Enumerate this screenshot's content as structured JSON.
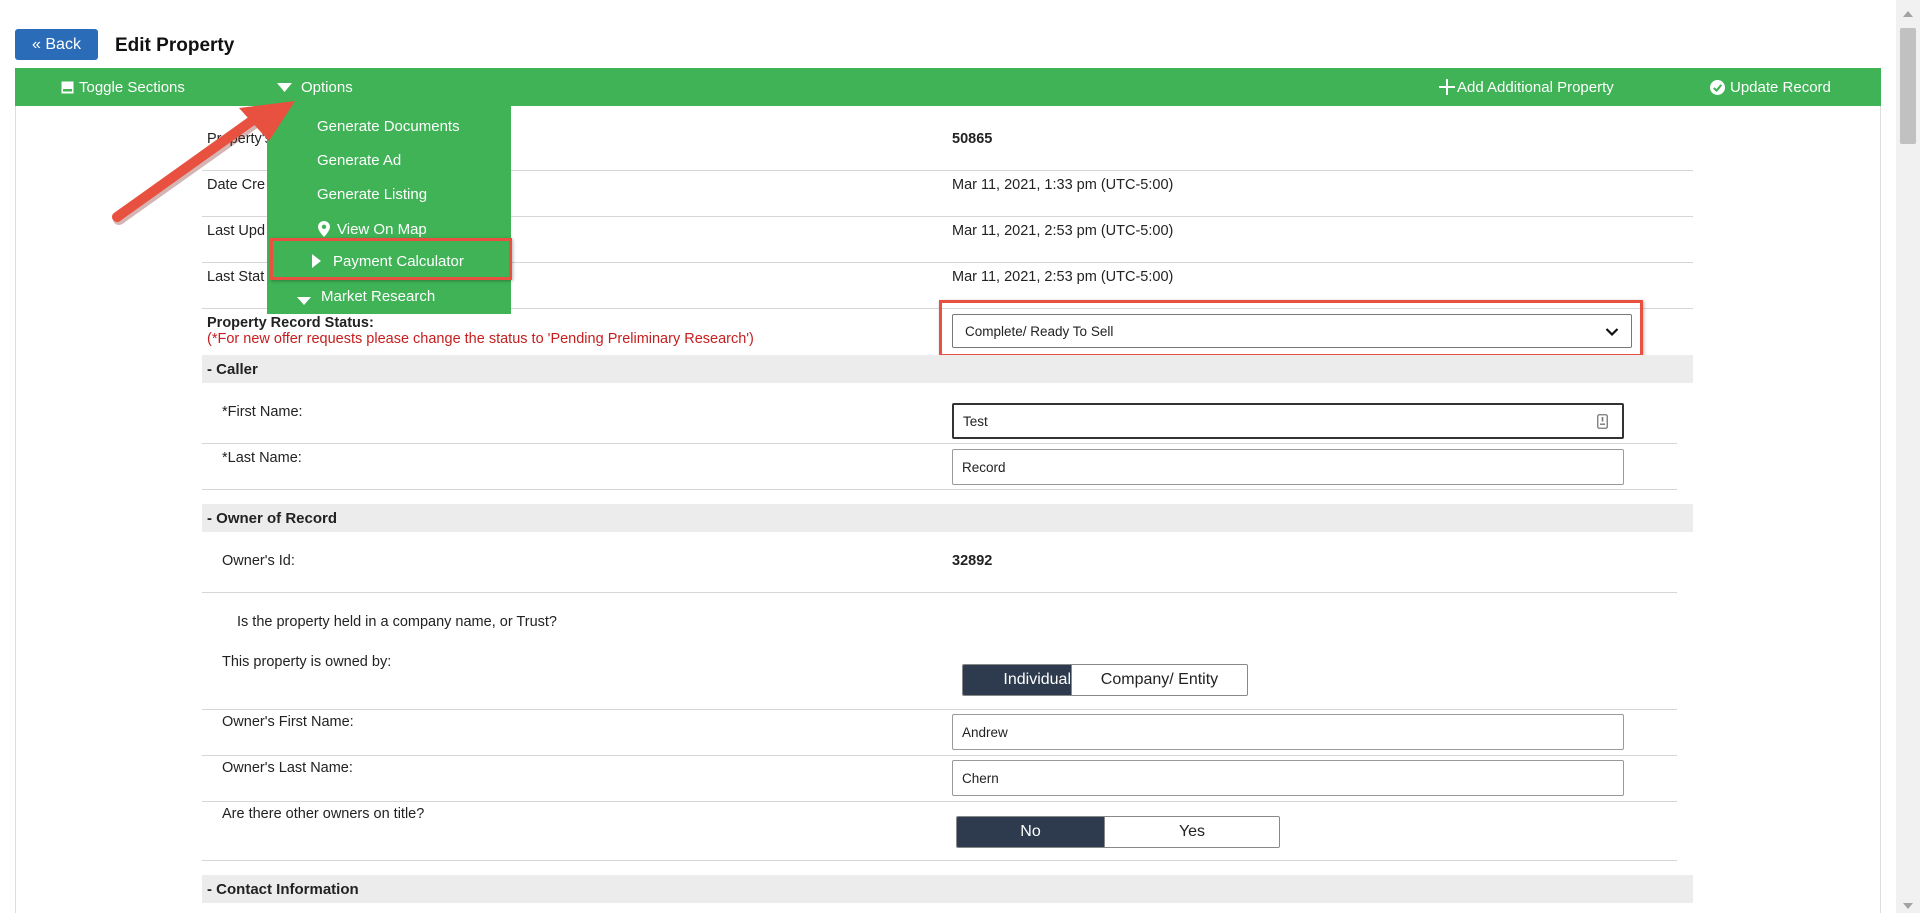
{
  "header": {
    "back_label": "« Back",
    "title": "Edit Property"
  },
  "toolbar": {
    "toggle_sections": "Toggle Sections",
    "options": "Options",
    "add_property": "Add Additional Property",
    "update_record": "Update Record"
  },
  "options_menu": {
    "items": [
      "Generate Documents",
      "Generate Ad",
      "Generate Listing",
      "View On Map",
      "Payment Calculator",
      "Market Research"
    ]
  },
  "property": {
    "id_label": "Property's",
    "id_value": "50865",
    "date_created_label": "Date Cre",
    "date_created_value": "Mar 11, 2021, 1:33 pm (UTC-5:00)",
    "last_updated_label": "Last Upd",
    "last_updated_value": "Mar 11, 2021, 2:53 pm (UTC-5:00)",
    "last_status_label": "Last Stat",
    "last_status_value": "Mar 11, 2021, 2:53 pm (UTC-5:00)",
    "status_label": "Property Record Status:",
    "status_note": "(*For new offer requests please change the status to 'Pending Preliminary Research')",
    "status_value": "Complete/ Ready To Sell"
  },
  "caller": {
    "section_title": "- Caller",
    "first_name_label": "*First Name:",
    "first_name_value": "Test",
    "last_name_label": "*Last Name:",
    "last_name_value": "Record"
  },
  "owner": {
    "section_title": "- Owner of Record",
    "id_label": "Owner's Id:",
    "id_value": "32892",
    "company_question": "Is the property held in a company name, or Trust?",
    "owned_by_label": "This property is owned by:",
    "owned_by_options": [
      "Individual",
      "Company/ Entity"
    ],
    "owned_by_selected": "Individual",
    "first_name_label": "Owner's First Name:",
    "first_name_value": "Andrew",
    "last_name_label": "Owner's Last Name:",
    "last_name_value": "Chern",
    "other_owners_label": "Are there other owners on title?",
    "other_owners_options": [
      "No",
      "Yes"
    ],
    "other_owners_selected": "No"
  },
  "contact": {
    "section_title": "- Contact Information"
  },
  "colors": {
    "toolbar_green": "#3fb356",
    "back_blue": "#2b6cb8",
    "annotation_red": "#e8503f",
    "toggle_dark": "#2e3b4e",
    "note_red": "#c61e1e"
  }
}
